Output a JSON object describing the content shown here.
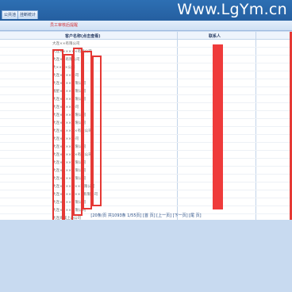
{
  "header": {
    "tabs": [
      {
        "label": "公共池"
      },
      {
        "label": "挂断统计"
      }
    ],
    "watermark": "Www.LgYm.cn"
  },
  "subbar": {
    "title": "员工审核后提醒"
  },
  "table": {
    "columns": [
      "客户名称(点击查看)",
      "联系人"
    ],
    "rows": [
      "大连××有限公司",
      "大连××××××有限公司",
      "大连××有限公司",
      "大××××公司",
      "大连××××公司",
      "大连××××有限公司",
      "瑞星××××有限公司",
      "大连××××有限公司",
      "大连××××公司",
      "大连××××有限公司",
      "大连××××有限公司",
      "大连××××××有限公司",
      "大连××××公司",
      "大连××××有限公司",
      "大连××××××有限公司",
      "大连××××有限公司",
      "大连××××有限公司",
      "大连××××有限公司",
      "大连×××××××有限公司",
      "大连××××××××有限公司",
      "大连××××有限公司",
      "大连××××有限公司",
      "大连海城上通公司"
    ]
  },
  "pager": {
    "text": "[20条/页 共1093条 1/55页] [首 页] [上一页] [下一页] [尾 页]"
  },
  "colors": {
    "topbar": "#2d6fb3",
    "redaction": "#e53935",
    "background": "#c8daf0"
  }
}
